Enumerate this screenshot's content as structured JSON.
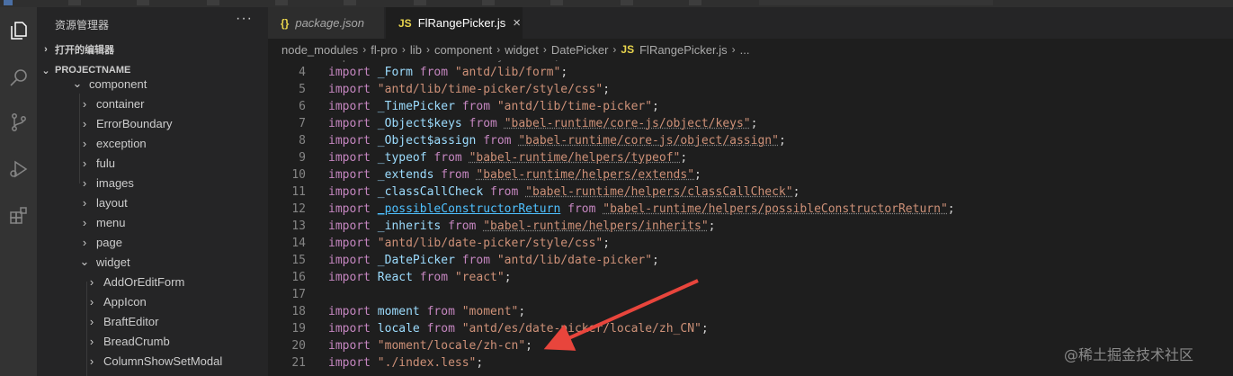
{
  "sidebar": {
    "title": "资源管理器",
    "more": "···",
    "open_editors": "打开的编辑器",
    "project": "PROJECTNAME",
    "tree": [
      {
        "label": "component",
        "expanded": true
      },
      {
        "label": "container"
      },
      {
        "label": "ErrorBoundary"
      },
      {
        "label": "exception"
      },
      {
        "label": "fulu"
      },
      {
        "label": "images"
      },
      {
        "label": "layout"
      },
      {
        "label": "menu"
      },
      {
        "label": "page"
      },
      {
        "label": "widget",
        "expanded": true
      },
      {
        "label": "AddOrEditForm"
      },
      {
        "label": "AppIcon"
      },
      {
        "label": "BraftEditor"
      },
      {
        "label": "BreadCrumb"
      },
      {
        "label": "ColumnShowSetModal"
      }
    ]
  },
  "tabs": [
    {
      "icon": "{}",
      "label": "package.json",
      "active": false
    },
    {
      "icon": "JS",
      "label": "FlRangePicker.js",
      "active": true,
      "close": "×"
    }
  ],
  "breadcrumb": [
    "node_modules",
    "fl-pro",
    "lib",
    "component",
    "widget",
    "DatePicker"
  ],
  "breadcrumb_file": {
    "icon": "JS",
    "label": "FlRangePicker.js"
  },
  "breadcrumb_tail": "...",
  "editor": {
    "lines": [
      {
        "n": "4",
        "t": "import _Form from \"antd/lib/form\";"
      },
      {
        "n": "5",
        "t": "import \"antd/lib/time-picker/style/css\";"
      },
      {
        "n": "6",
        "t": "import _TimePicker from \"antd/lib/time-picker\";"
      },
      {
        "n": "7",
        "t": "import _Object$keys from \"babel-runtime/core-js/object/keys\";"
      },
      {
        "n": "8",
        "t": "import _Object$assign from \"babel-runtime/core-js/object/assign\";"
      },
      {
        "n": "9",
        "t": "import _typeof from \"babel-runtime/helpers/typeof\";"
      },
      {
        "n": "10",
        "t": "import _extends from \"babel-runtime/helpers/extends\";"
      },
      {
        "n": "11",
        "t": "import _classCallCheck from \"babel-runtime/helpers/classCallCheck\";"
      },
      {
        "n": "12",
        "t": "import _possibleConstructorReturn from \"babel-runtime/helpers/possibleConstructorReturn\";"
      },
      {
        "n": "13",
        "t": "import _inherits from \"babel-runtime/helpers/inherits\";"
      },
      {
        "n": "14",
        "t": "import \"antd/lib/date-picker/style/css\";"
      },
      {
        "n": "15",
        "t": "import _DatePicker from \"antd/lib/date-picker\";"
      },
      {
        "n": "16",
        "t": "import React from \"react\";"
      },
      {
        "n": "17",
        "t": ""
      },
      {
        "n": "18",
        "t": "import moment from \"moment\";"
      },
      {
        "n": "19",
        "t": "import locale from \"antd/es/date-picker/locale/zh_CN\";"
      },
      {
        "n": "20",
        "t": "import \"moment/locale/zh-cn\";"
      },
      {
        "n": "21",
        "t": "import \"./index.less\";"
      }
    ]
  },
  "watermark": "@稀土掘金技术社区",
  "colors": {
    "keyword": "#c586c0",
    "identifier": "#9cdcfe",
    "string": "#ce9178",
    "arrow": "#e8453c",
    "js_icon": "#e8d44d"
  }
}
